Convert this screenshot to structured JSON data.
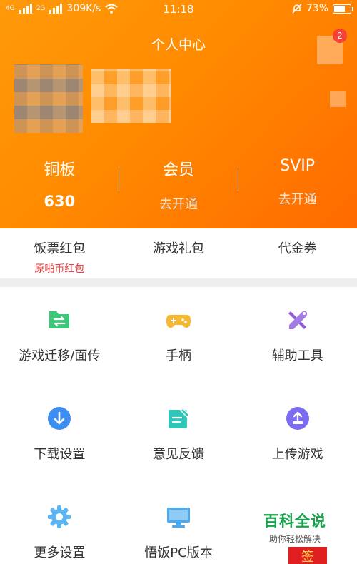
{
  "status_bar": {
    "sim1": "4G",
    "sim2": "2G",
    "speed": "309K/s",
    "time": "11:18",
    "battery": "73%",
    "battery_level": 0.73
  },
  "header": {
    "title": "个人中心",
    "message_badge": "2"
  },
  "stats": [
    {
      "label": "铜板",
      "value": "630"
    },
    {
      "label": "会员",
      "value": "去开通"
    },
    {
      "label": "SVIP",
      "value": "去开通"
    }
  ],
  "quick_links": [
    {
      "label": "饭票红包",
      "sub": "原啪币红包"
    },
    {
      "label": "游戏礼包",
      "sub": ""
    },
    {
      "label": "代金券",
      "sub": ""
    }
  ],
  "menu": [
    {
      "label": "游戏迁移/面传",
      "icon": "transfer-folder-icon",
      "color": "#3cc77a"
    },
    {
      "label": "手柄",
      "icon": "gamepad-icon",
      "color": "#f5b82e"
    },
    {
      "label": "辅助工具",
      "icon": "tools-icon",
      "color": "#8e5bd6"
    },
    {
      "label": "下载设置",
      "icon": "download-icon",
      "color": "#3d8ef0"
    },
    {
      "label": "意见反馈",
      "icon": "feedback-icon",
      "color": "#2fc6b8"
    },
    {
      "label": "上传游戏",
      "icon": "upload-icon",
      "color": "#7b6cf0"
    },
    {
      "label": "更多设置",
      "icon": "gear-icon",
      "color": "#5db6f2"
    },
    {
      "label": "悟饭PC版本",
      "icon": "monitor-icon",
      "color": "#4aa9ef"
    }
  ],
  "watermark": {
    "title": "百科全说",
    "subtitle": "助你轻松解决"
  },
  "promo": {
    "label": "签"
  }
}
